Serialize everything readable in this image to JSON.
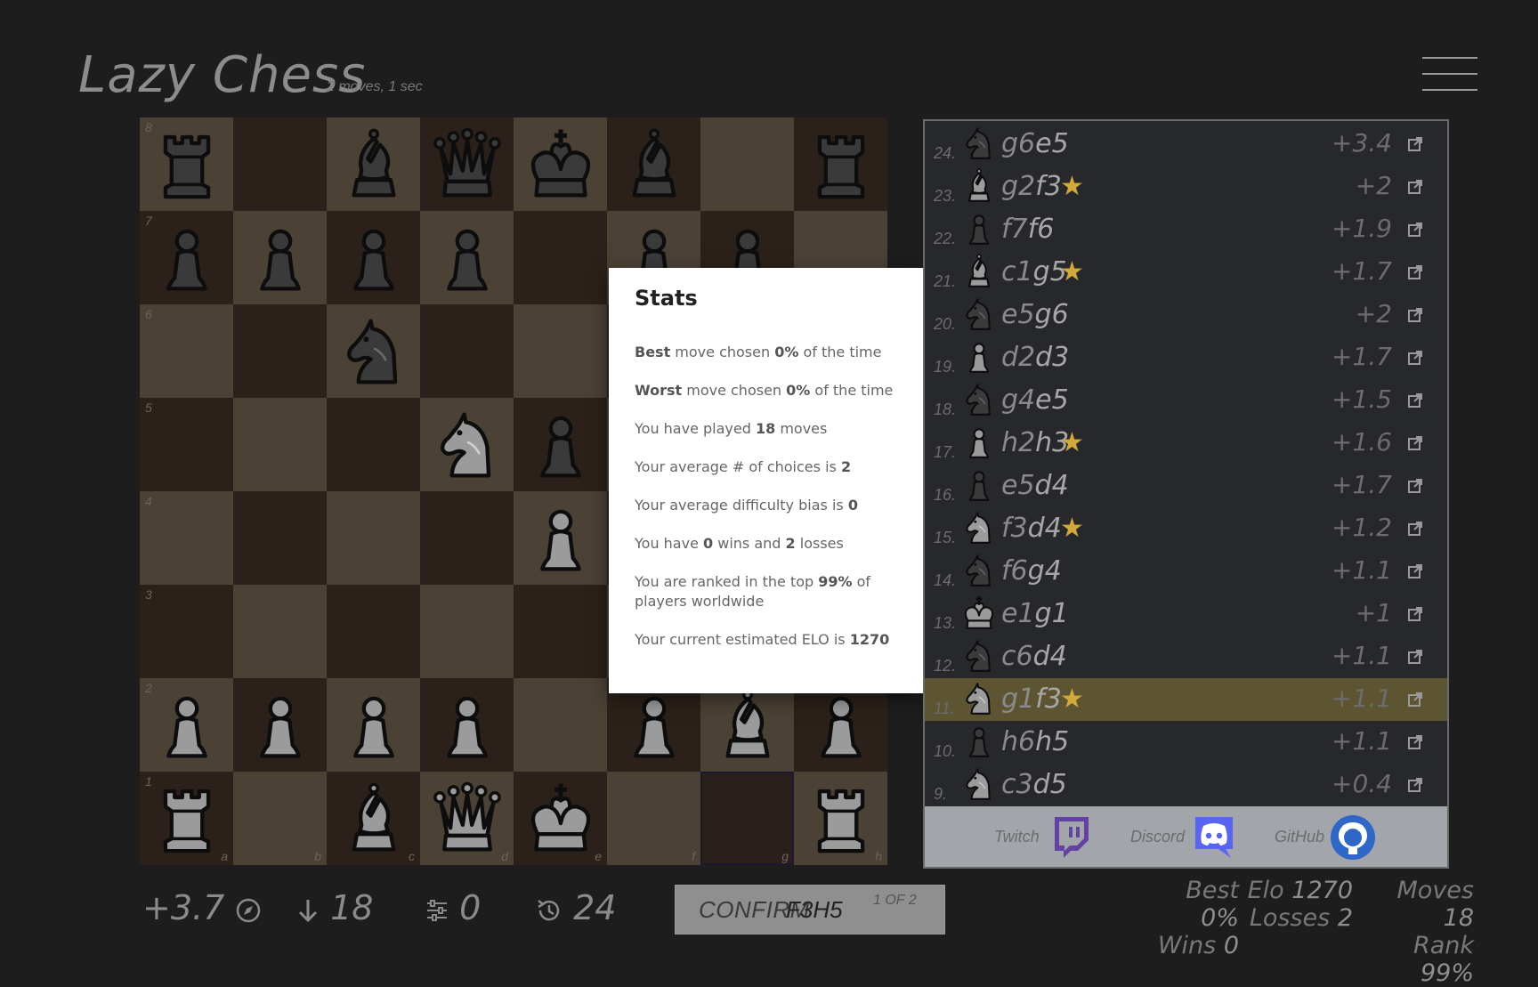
{
  "header": {
    "title": "Lazy Chess",
    "subtitle": "2 moves, 1 sec"
  },
  "board": {
    "rank_labels": [
      "8",
      "7",
      "6",
      "5",
      "4",
      "3",
      "2",
      "1"
    ],
    "file_labels": [
      "a",
      "b",
      "c",
      "d",
      "e",
      "f",
      "g",
      "h"
    ],
    "selected_square": "g1",
    "pieces": [
      {
        "sq": "a8",
        "p": "r"
      },
      {
        "sq": "c8",
        "p": "b"
      },
      {
        "sq": "d8",
        "p": "q"
      },
      {
        "sq": "e8",
        "p": "k"
      },
      {
        "sq": "f8",
        "p": "b"
      },
      {
        "sq": "h8",
        "p": "r"
      },
      {
        "sq": "a7",
        "p": "p"
      },
      {
        "sq": "b7",
        "p": "p"
      },
      {
        "sq": "c7",
        "p": "p"
      },
      {
        "sq": "d7",
        "p": "p"
      },
      {
        "sq": "f7",
        "p": "p"
      },
      {
        "sq": "g7",
        "p": "p"
      },
      {
        "sq": "c6",
        "p": "n"
      },
      {
        "sq": "d5",
        "p": "N"
      },
      {
        "sq": "e5",
        "p": "p"
      },
      {
        "sq": "e4",
        "p": "P"
      },
      {
        "sq": "a2",
        "p": "P"
      },
      {
        "sq": "b2",
        "p": "P"
      },
      {
        "sq": "c2",
        "p": "P"
      },
      {
        "sq": "d2",
        "p": "P"
      },
      {
        "sq": "f2",
        "p": "P"
      },
      {
        "sq": "g2",
        "p": "B"
      },
      {
        "sq": "h2",
        "p": "P"
      },
      {
        "sq": "a1",
        "p": "R"
      },
      {
        "sq": "c1",
        "p": "B"
      },
      {
        "sq": "d1",
        "p": "Q"
      },
      {
        "sq": "e1",
        "p": "K"
      },
      {
        "sq": "h1",
        "p": "R"
      }
    ]
  },
  "stats_modal": {
    "title": "Stats",
    "best": {
      "pre": "Best",
      "mid": " move chosen ",
      "val": "0%",
      "post": " of the time"
    },
    "worst": {
      "pre": "Worst",
      "mid": " move chosen ",
      "val": "0%",
      "post": " of the time"
    },
    "played": {
      "pre": "You have played ",
      "val": "18",
      "post": " moves"
    },
    "choices": {
      "pre": "Your average # of choices is ",
      "val": "2"
    },
    "bias": {
      "pre": "Your average difficulty bias is ",
      "val": "0"
    },
    "record": {
      "pre": "You have ",
      "wins": "0",
      "mid": " wins and ",
      "losses": "2",
      "post": " losses"
    },
    "rank": {
      "pre": "You are ranked in the top ",
      "val": "99%",
      "post": " of players worldwide"
    },
    "elo": {
      "pre": "Your current estimated ELO is ",
      "val": "1270"
    }
  },
  "move_list": [
    {
      "num": "24.",
      "piece": "n",
      "from": "g6",
      "to": "e5",
      "star": false,
      "eval": "+3.4"
    },
    {
      "num": "23.",
      "piece": "B",
      "from": "g2",
      "to": "f3",
      "star": true,
      "eval": "+2"
    },
    {
      "num": "22.",
      "piece": "p",
      "from": "f7",
      "to": "f6",
      "star": false,
      "eval": "+1.9"
    },
    {
      "num": "21.",
      "piece": "B",
      "from": "c1",
      "to": "g5",
      "star": true,
      "eval": "+1.7"
    },
    {
      "num": "20.",
      "piece": "n",
      "from": "e5",
      "to": "g6",
      "star": false,
      "eval": "+2"
    },
    {
      "num": "19.",
      "piece": "P",
      "from": "d2",
      "to": "d3",
      "star": false,
      "eval": "+1.7"
    },
    {
      "num": "18.",
      "piece": "n",
      "from": "g4",
      "to": "e5",
      "star": false,
      "eval": "+1.5"
    },
    {
      "num": "17.",
      "piece": "P",
      "from": "h2",
      "to": "h3",
      "star": true,
      "eval": "+1.6"
    },
    {
      "num": "16.",
      "piece": "p",
      "from": "e5",
      "to": "d4",
      "star": false,
      "eval": "+1.7"
    },
    {
      "num": "15.",
      "piece": "N",
      "from": "f3",
      "to": "d4",
      "star": true,
      "eval": "+1.2"
    },
    {
      "num": "14.",
      "piece": "n",
      "from": "f6",
      "to": "g4",
      "star": false,
      "eval": "+1.1"
    },
    {
      "num": "13.",
      "piece": "K",
      "from": "e1",
      "to": "g1",
      "star": false,
      "eval": "+1"
    },
    {
      "num": "12.",
      "piece": "n",
      "from": "c6",
      "to": "d4",
      "star": false,
      "eval": "+1.1"
    },
    {
      "num": "11.",
      "piece": "N",
      "from": "g1",
      "to": "f3",
      "star": true,
      "eval": "+1.1",
      "highlight": true
    },
    {
      "num": "10.",
      "piece": "p",
      "from": "h6",
      "to": "h5",
      "star": false,
      "eval": "+1.1"
    },
    {
      "num": "9.",
      "piece": "N",
      "from": "c3",
      "to": "d5",
      "star": false,
      "eval": "+0.4"
    }
  ],
  "social": {
    "twitch": "Twitch",
    "discord": "Discord",
    "github": "GitHub"
  },
  "bottom_bar": {
    "eval": "+3.7",
    "depth": "18",
    "bias": "0",
    "history": "24",
    "confirm_label": "CONFIRM",
    "confirm_move": "F3H5",
    "confirm_count": "1 OF 2"
  },
  "summary": {
    "best_label": "Best",
    "best_val": "0%",
    "elo_label": "Elo",
    "elo_val": "1270",
    "moves_label": "Moves",
    "moves_val": "18",
    "wins_label": "Wins",
    "wins_val": "0",
    "losses_label": "Losses",
    "losses_val": "2",
    "rank_label": "Rank",
    "rank_val": "99%"
  },
  "colors": {
    "accent": "#d3a93b",
    "highlight_row": "#5d5531",
    "light_square": "#4b4135",
    "dark_square": "#2c211a",
    "twitch": "#6441a5",
    "discord": "#5865f2",
    "github": "#2f66c8"
  }
}
